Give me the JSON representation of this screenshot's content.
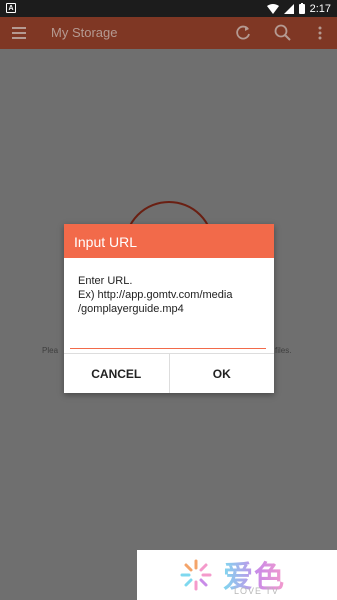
{
  "status_bar": {
    "time": "2:17",
    "left_icon": "A"
  },
  "app_bar": {
    "title": "My Storage",
    "icons": [
      "menu-icon",
      "refresh-icon",
      "search-icon",
      "more-vert-icon"
    ]
  },
  "background": {
    "text_left": "Plea",
    "text_right": "files."
  },
  "dialog": {
    "title": "Input URL",
    "message_line1": "Enter URL.",
    "message_line2": "Ex) http://app.gomtv.com/media",
    "message_line3": "/gomplayerguide.mp4",
    "input_value": "",
    "cancel_label": "CANCEL",
    "ok_label": "OK"
  },
  "watermark": {
    "logo_text": "爱色",
    "sub_text": "LOVE TV"
  },
  "colors": {
    "accent": "#f26a4a",
    "app_bar_dimmed": "#7f3724",
    "scrim": "#6f6f6f"
  }
}
